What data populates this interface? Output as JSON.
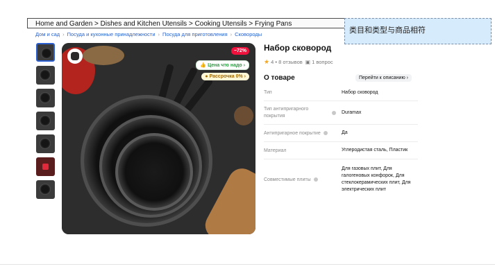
{
  "breadcrumb_en": "Home and Garden > Dishes and Kitchen Utensils > Cooking Utensils > Frying Pans",
  "breadcrumb_ru": [
    "Дом и сад",
    "Посуда и кухонные принадлежности",
    "Посуда для приготовления",
    "Сковороды"
  ],
  "annotation_note": "类目和类型与商品相符",
  "product": {
    "title": "Набор сковород",
    "rating_value": "4",
    "reviews": "8 отзывов",
    "questions": "1 вопрос",
    "discount_badge": "−72%",
    "price_tag": "Цена что надо",
    "installment_tag": "Рассрочка 0%"
  },
  "about": {
    "title": "О товаре",
    "goto_description": "Перейти к описанию"
  },
  "specs": [
    {
      "name": "Тип",
      "value": "Набор сковород",
      "info": false
    },
    {
      "name": "Тип антипригарного покрытия",
      "value": "Duramax",
      "info": true
    },
    {
      "name": "Антипригарное покрытие",
      "value": "Да",
      "info": true
    },
    {
      "name": "Материал",
      "value": "Углеродистая сталь, Пластик",
      "info": false
    },
    {
      "name": "Совместимые плиты",
      "value": "Для газовых плит, Для галогеновых конфорок, Для стеклокерамических плит, Для электрических плит",
      "info": true
    }
  ],
  "thumbnails": [
    "pan",
    "pan",
    "pan",
    "pan",
    "pan",
    "red-badge",
    "pan"
  ],
  "colors": {
    "link": "#2a62c9",
    "accent_red": "#f0113d",
    "accent_green": "#21a23a",
    "star": "#f5a623",
    "active_thumb": "#2c5fd0"
  }
}
